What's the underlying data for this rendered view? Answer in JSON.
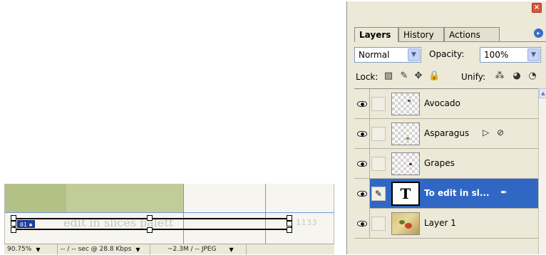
{
  "canvas": {
    "faded_top_text": "",
    "ghost_text": "edit in slices palett",
    "ghost_text_right": "1133",
    "ghost_small": "",
    "slice_badge": "01"
  },
  "status_bar": {
    "zoom": "90.75%",
    "download": "-- / -- sec @ 28.8 Kbps",
    "size": "~2.3M / -- JPEG"
  },
  "palette": {
    "close_glyph": "×",
    "tabs": [
      {
        "label": "Layers",
        "active": true
      },
      {
        "label": "History",
        "active": false
      },
      {
        "label": "Actions",
        "active": false
      }
    ],
    "blend_mode": "Normal",
    "opacity_label": "Opacity:",
    "opacity_value": "100%",
    "lock_label": "Lock:",
    "unify_label": "Unify:",
    "layers": [
      {
        "name": "Avocado",
        "type": "image",
        "selected": false
      },
      {
        "name": "Asparagus",
        "type": "image",
        "selected": false
      },
      {
        "name": "Grapes",
        "type": "image",
        "selected": false
      },
      {
        "name": "To edit in sl...",
        "type": "text",
        "selected": true
      },
      {
        "name": "Layer 1",
        "type": "photo",
        "selected": false
      }
    ]
  },
  "icons": {
    "eye": "eye-icon",
    "brush": "brush-icon",
    "lock": "lock-icon",
    "move": "move-icon",
    "chevron": "chevron-down-icon"
  }
}
